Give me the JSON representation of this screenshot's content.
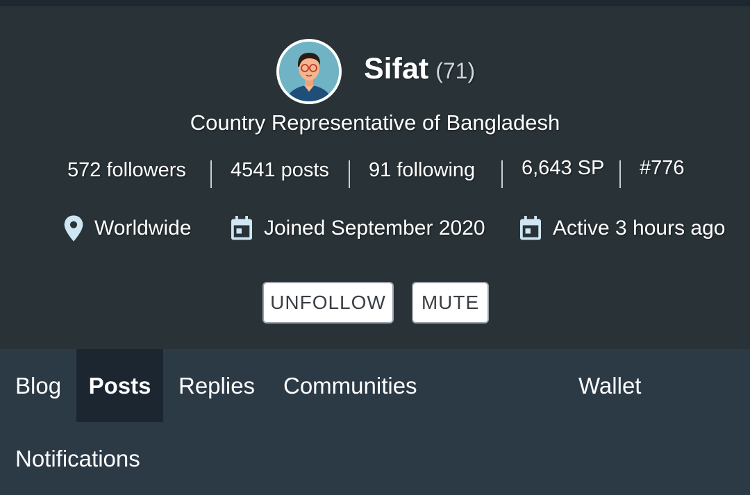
{
  "profile": {
    "name": "Sifat",
    "reputation": "(71)",
    "about": "Country Representative of Bangladesh",
    "avatar_icon": "user-avatar"
  },
  "stats": {
    "followers": "572 followers",
    "posts": "4541 posts",
    "following": "91 following",
    "sp": "6,643 SP",
    "rank": "#776"
  },
  "meta": {
    "location": "Worldwide",
    "joined": "Joined September 2020",
    "active": "Active 3 hours ago",
    "location_icon": "location-pin-icon",
    "calendar_icon": "calendar-icon"
  },
  "actions": {
    "unfollow": "UNFOLLOW",
    "mute": "MUTE"
  },
  "tabs": {
    "blog": "Blog",
    "posts": "Posts",
    "replies": "Replies",
    "communities": "Communities",
    "wallet": "Wallet",
    "notifications": "Notifications",
    "active_tab": "Posts"
  },
  "colors": {
    "header_bg": "#293236",
    "tabs_bg": "#2c3a46",
    "active_tab_bg": "#1c2630",
    "icon": "#cfe6f5"
  }
}
